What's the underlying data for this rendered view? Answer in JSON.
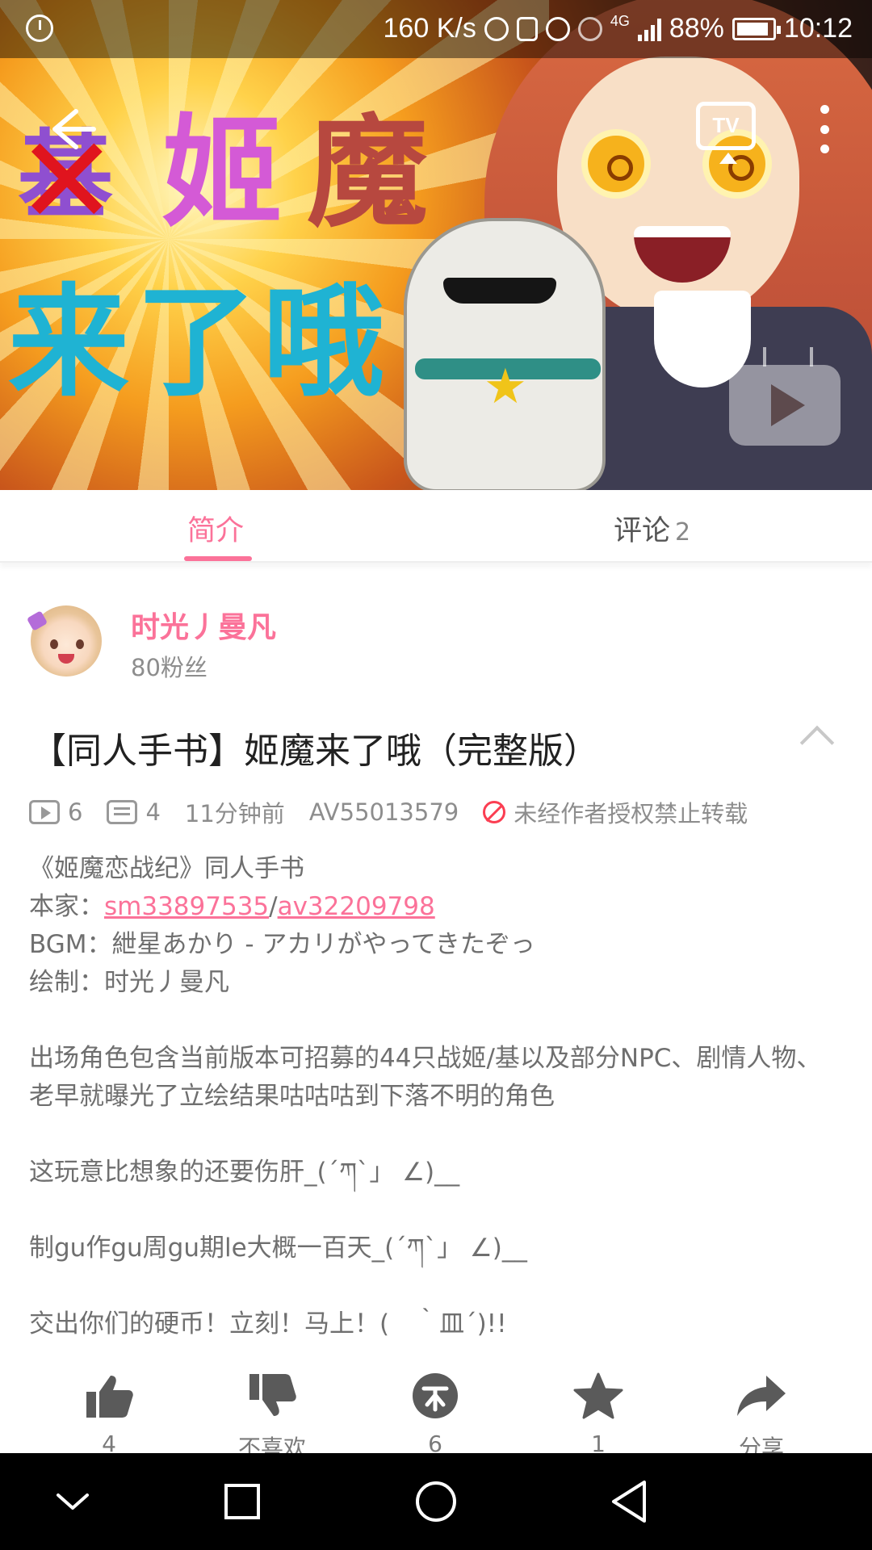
{
  "status_bar": {
    "net_speed": "160 K/s",
    "network_type": "4G",
    "battery": "88%",
    "time": "10:12"
  },
  "player": {
    "tv_label": "TV",
    "cover_text": {
      "struck_char": "基",
      "line1": "姬魔",
      "line2": "来了哦"
    }
  },
  "tabs": [
    {
      "label": "简介",
      "active": true
    },
    {
      "label": "评论",
      "count": "2",
      "active": false
    }
  ],
  "uploader": {
    "name": "时光丿曼凡",
    "fans": "80粉丝"
  },
  "video": {
    "title": "【同人手书】姬魔来了哦（完整版）",
    "plays": "6",
    "danmaku": "4",
    "time_ago": "11分钟前",
    "av_id": "AV55013579",
    "copyright": "未经作者授权禁止转载"
  },
  "description": {
    "line1": "《姬魔恋战纪》同人手书",
    "source_prefix": "本家：",
    "source_link1": "sm33897535",
    "source_sep": "/",
    "source_link2": "av32209798",
    "bgm": "BGM：紲星あかり - アカリがやってきたぞっ",
    "artist": "绘制：时光丿曼凡",
    "para1": "出场角色包含当前版本可招募的44只战姬/基以及部分NPC、剧情人物、老早就曝光了立绘结果咕咕咕到下落不明的角色",
    "para2": "这玩意比想象的还要伤肝_(´ཀ`」 ∠)__",
    "para3": "制gu作gu周gu期le大概一百天_(´ཀ`」 ∠)__",
    "para4": "交出你们的硬币！立刻！马上！(　｀皿´)!!"
  },
  "actions": [
    {
      "icon": "thumbs-up-icon",
      "label": "4"
    },
    {
      "icon": "thumbs-down-icon",
      "label": "不喜欢"
    },
    {
      "icon": "coin-icon",
      "label": "6"
    },
    {
      "icon": "star-icon",
      "label": "1"
    },
    {
      "icon": "share-icon",
      "label": "分享"
    }
  ],
  "colors": {
    "accent": "#fb7299",
    "warning": "#fb3e52"
  }
}
